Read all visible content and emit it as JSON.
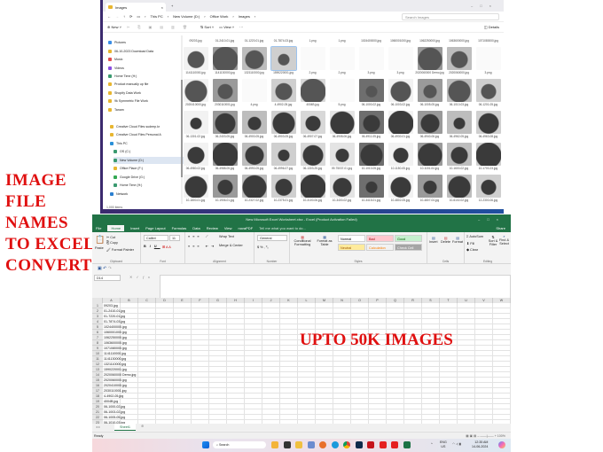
{
  "promo": {
    "lines": [
      "IMAGE",
      "FILE",
      "NAMES",
      "TO EXCEL",
      "CONVERT"
    ],
    "badge": "UPTO 50K IMAGES",
    "color": "#e01010"
  },
  "explorer": {
    "tab_title": "Images",
    "breadcrumb": [
      "This PC",
      "New Volume (D:)",
      "Office Work",
      "Images"
    ],
    "search_placeholder": "Search Images",
    "toolbar": {
      "new": "New",
      "sort": "Sort",
      "view": "View",
      "more": "···",
      "details": "Details"
    },
    "sidebar": [
      {
        "label": "Pictures",
        "icon": "pictures-icon"
      },
      {
        "label": "06-10-2023 Download Data",
        "icon": "folder-icon"
      },
      {
        "label": "Music",
        "icon": "music-icon"
      },
      {
        "label": "Videos",
        "icon": "videos-icon"
      },
      {
        "label": "Home Time (H:)",
        "icon": "drive-icon"
      },
      {
        "label": "Product manually up file",
        "icon": "folder-icon"
      },
      {
        "label": "Shopify Data Work",
        "icon": "folder-icon"
      },
      {
        "label": "9k Symmetric File Work",
        "icon": "folder-icon"
      },
      {
        "label": "Tanam",
        "icon": "folder-icon"
      },
      {
        "label": "Creative Cloud Files sudeep.kr",
        "icon": "folder-icon"
      },
      {
        "label": "Creative Cloud Files Personal A",
        "icon": "folder-icon"
      },
      {
        "label": "This PC",
        "icon": "pc-icon"
      },
      {
        "label": "OS (C:)",
        "icon": "drive-icon"
      },
      {
        "label": "New Volume (D:)",
        "icon": "drive-icon",
        "selected": true
      },
      {
        "label": "Office Place (F:)",
        "icon": "folder-icon"
      },
      {
        "label": "Google Drive (G:)",
        "icon": "google-drive-icon"
      },
      {
        "label": "Home Time (H:)",
        "icon": "drive-icon"
      },
      {
        "label": "Network",
        "icon": "network-icon"
      }
    ],
    "status": "1,000 items",
    "files": [
      [
        "09203.jpg",
        "01-2410-01.jpg",
        "01-1220-01.jpg",
        "01-7874-03.jpg",
        "1.png",
        "1.png",
        "1024400000.jpg",
        "1060001000.jpg",
        "1062250000.jpg",
        "1063600000.jpg",
        "1071080000.jpg"
      ],
      [
        "1141110000.jpg",
        "1141130000.jpg",
        "1321110000.jpg",
        "1590220001.jpg",
        "2.png",
        "2.png",
        "3.png",
        "3.png",
        "2020060000 Demo.jpg",
        "2020060000.jpg",
        "3.png"
      ],
      [
        "2020410000.jpg",
        "2030110001.jpg",
        "4.png",
        "4-4902-05.jpg",
        "4004B.jpg",
        "5.png",
        "06-1000-02.jpg",
        "06-1003-02.jpg",
        "06-1005-05.jpg",
        "06-1010-03.jpg",
        "06-1201-05.jpg"
      ],
      [
        "06-1301-02.jpg",
        "06-2403-05.jpg",
        "06-4900-05.jpg",
        "06-4903-05.jpg",
        "06-4907-07.jpg",
        "06-4908-06.jpg",
        "06-4911-05.jpg",
        "06-4930-01.jpg",
        "06-4940-06.jpg",
        "06-4962-05.jpg",
        "06-4963-08.jpg"
      ],
      [
        "06-4980-02.jpg",
        "06-4988-05.jpg",
        "06-4990-05.jpg",
        "06-4996-07.jpg",
        "06-1303-25.jpg",
        "09-75037-01.jpg",
        "10-1010-05.jpg",
        "10-1150-05.jpg",
        "10-1151-04.jpg",
        "10-1600-02.jpg",
        "10-1700-23.jpg"
      ],
      [
        "10-1800-01.jpg",
        "10-1906-01.jpg",
        "10-2327-02.jpg",
        "10-2375-01.jpg",
        "10-3100-06.jpg",
        "10-3400-02.jpg",
        "10-3415-01.jpg",
        "10-4802-05.jpg",
        "10-4807-04.jpg",
        "10-6102-02.jpg",
        "12-2300-06.jpg"
      ]
    ],
    "selected_file": "1590220001.jpg"
  },
  "excel": {
    "title": "New Microsoft Excel Worksheet.xlsx - Excel (Product Activation Failed)",
    "tabs": [
      "File",
      "Home",
      "Insert",
      "Page Layout",
      "Formulas",
      "Data",
      "Review",
      "View",
      "novaPDF"
    ],
    "active_tab": "Home",
    "tell_me": "Tell me what you want to do...",
    "share": "Share",
    "ribbon": {
      "paste": "Paste",
      "cut": "Cut",
      "copy": "Copy",
      "format_painter": "Format Painter",
      "clipboard": "Clipboard",
      "font_name": "Calibri",
      "font_size": "11",
      "font": "Font",
      "wrap_text": "Wrap Text",
      "merge_center": "Merge & Center",
      "alignment": "Alignment",
      "number_format": "General",
      "number": "Number",
      "conditional": "Conditional Formatting",
      "format_table": "Format as Table",
      "styles_list": [
        {
          "label": "Normal",
          "bg": "#ffffff",
          "fg": "#000000"
        },
        {
          "label": "Bad",
          "bg": "#ffc7ce",
          "fg": "#9c0006"
        },
        {
          "label": "Good",
          "bg": "#c6efce",
          "fg": "#006100"
        },
        {
          "label": "Neutral",
          "bg": "#ffeb9c",
          "fg": "#9c5700"
        },
        {
          "label": "Calculation",
          "bg": "#f2f2f2",
          "fg": "#fa7d00"
        },
        {
          "label": "Check Cell",
          "bg": "#a5a5a5",
          "fg": "#ffffff"
        }
      ],
      "styles": "Styles",
      "insert": "Insert",
      "delete": "Delete",
      "format": "Format",
      "cells": "Cells",
      "autosum": "AutoSum",
      "fill": "Fill",
      "clear": "Clear",
      "sort_filter": "Sort & Filter",
      "find_select": "Find & Select",
      "editing": "Editing"
    },
    "name_box": "D14",
    "columns": [
      "A",
      "B",
      "C",
      "D",
      "E",
      "F",
      "G",
      "H",
      "I",
      "J",
      "K",
      "L",
      "M",
      "N",
      "O",
      "P",
      "Q",
      "R",
      "S",
      "T",
      "U",
      "V",
      "W"
    ],
    "column_a": [
      "09203.jpg",
      "01-2410-01.jpg",
      "01-7220-01.jpg",
      "01-7874-03.jpg",
      "1024400000.jpg",
      "1060001000.jpg",
      "1062250000.jpg",
      "1063600000.jpg",
      "1071080000.jpg",
      "1141110000.jpg",
      "1141130000.jpg",
      "1321110000.jpg",
      "1590220001.jpg",
      "2020060000 Demo.jpg",
      "2020060000.jpg",
      "2020410000.jpg",
      "2030110001.jpg",
      "4-4902-05.jpg",
      "4004B.jpg",
      "06-1000-02.jpg",
      "06-1003-02.jpg",
      "06-1005-05.jpg",
      "06-1010-03.jpg"
    ],
    "sheet_tab": "Sheet1",
    "status": "Ready",
    "accent": "#217346"
  },
  "taskbar": {
    "search": "Search",
    "lang": "ENG",
    "region": "US",
    "time": "12:35 AM",
    "date": "14-06-2024"
  }
}
